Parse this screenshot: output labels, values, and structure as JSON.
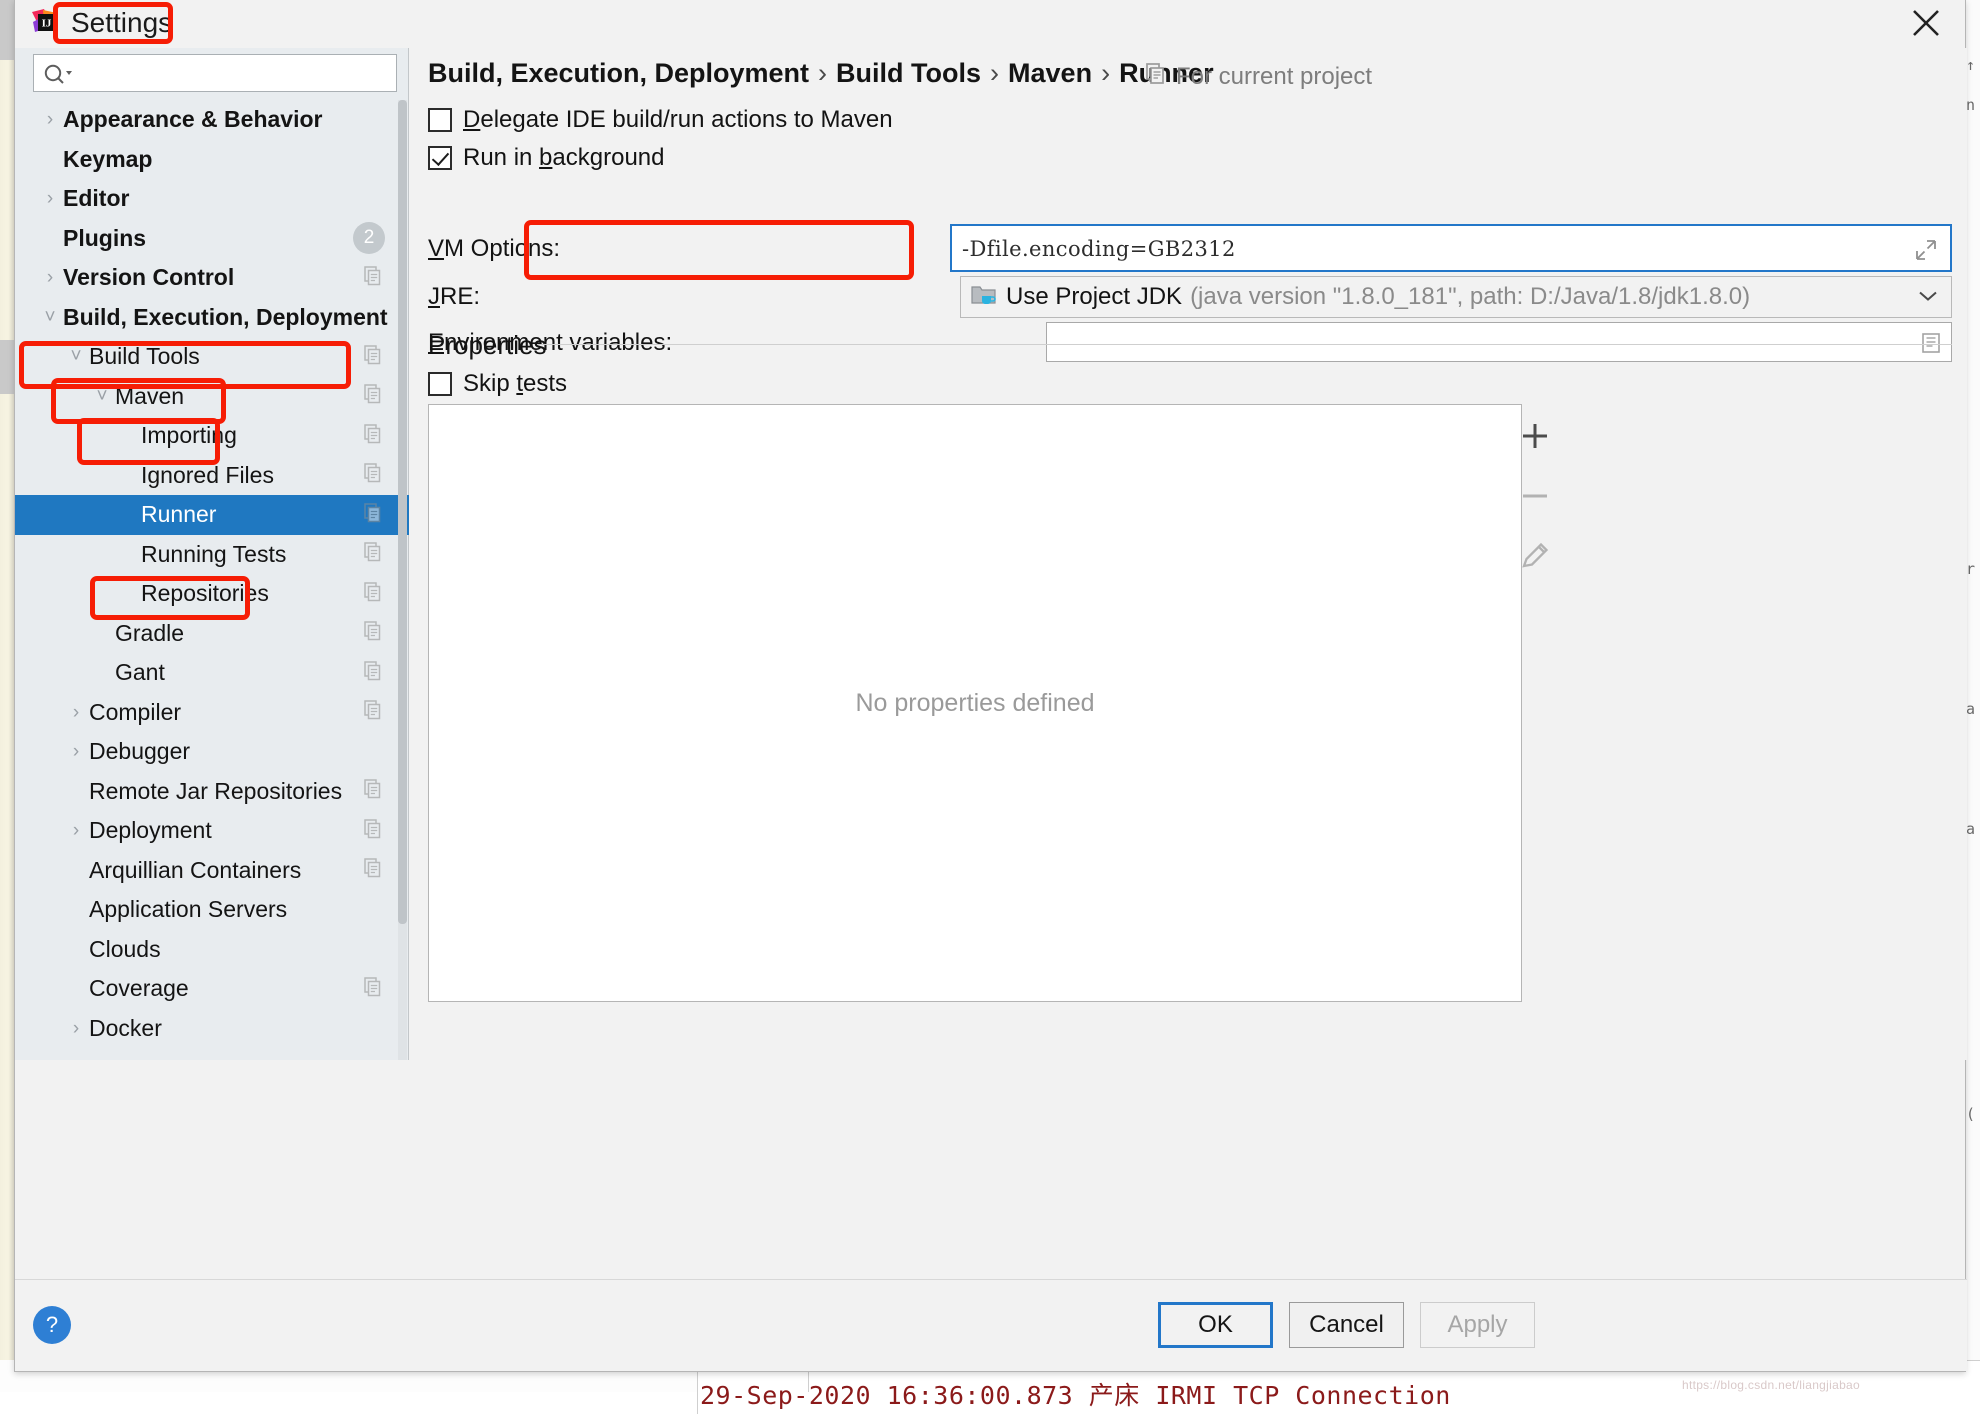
{
  "window": {
    "title": "Settings",
    "app_icon": "intellij-idea-logo",
    "close_icon": "close-icon"
  },
  "search": {
    "value": "",
    "placeholder": "",
    "icon": "search-icon"
  },
  "sidebar": {
    "items": [
      {
        "label": "Appearance & Behavior",
        "arrow": "›",
        "indent": 0,
        "bold": true,
        "copy": false,
        "selected": false
      },
      {
        "label": "Keymap",
        "arrow": "",
        "indent": 0,
        "bold": true,
        "copy": false,
        "selected": false
      },
      {
        "label": "Editor",
        "arrow": "›",
        "indent": 0,
        "bold": true,
        "copy": false,
        "selected": false
      },
      {
        "label": "Plugins",
        "arrow": "",
        "indent": 0,
        "bold": true,
        "copy": false,
        "selected": false,
        "badge": "2"
      },
      {
        "label": "Version Control",
        "arrow": "›",
        "indent": 0,
        "bold": true,
        "copy": true,
        "selected": false
      },
      {
        "label": "Build, Execution, Deployment",
        "arrow": "˅",
        "indent": 0,
        "bold": true,
        "copy": false,
        "selected": false
      },
      {
        "label": "Build Tools",
        "arrow": "˅",
        "indent": 1,
        "bold": false,
        "copy": true,
        "selected": false
      },
      {
        "label": "Maven",
        "arrow": "˅",
        "indent": 2,
        "bold": false,
        "copy": true,
        "selected": false
      },
      {
        "label": "Importing",
        "arrow": "",
        "indent": 3,
        "bold": false,
        "copy": true,
        "selected": false
      },
      {
        "label": "Ignored Files",
        "arrow": "",
        "indent": 3,
        "bold": false,
        "copy": true,
        "selected": false
      },
      {
        "label": "Runner",
        "arrow": "",
        "indent": 3,
        "bold": false,
        "copy": true,
        "selected": true
      },
      {
        "label": "Running Tests",
        "arrow": "",
        "indent": 3,
        "bold": false,
        "copy": true,
        "selected": false
      },
      {
        "label": "Repositories",
        "arrow": "",
        "indent": 3,
        "bold": false,
        "copy": true,
        "selected": false
      },
      {
        "label": "Gradle",
        "arrow": "",
        "indent": 2,
        "bold": false,
        "copy": true,
        "selected": false
      },
      {
        "label": "Gant",
        "arrow": "",
        "indent": 2,
        "bold": false,
        "copy": true,
        "selected": false
      },
      {
        "label": "Compiler",
        "arrow": "›",
        "indent": 1,
        "bold": false,
        "copy": true,
        "selected": false
      },
      {
        "label": "Debugger",
        "arrow": "›",
        "indent": 1,
        "bold": false,
        "copy": false,
        "selected": false
      },
      {
        "label": "Remote Jar Repositories",
        "arrow": "",
        "indent": 1,
        "bold": false,
        "copy": true,
        "selected": false
      },
      {
        "label": "Deployment",
        "arrow": "›",
        "indent": 1,
        "bold": false,
        "copy": true,
        "selected": false
      },
      {
        "label": "Arquillian Containers",
        "arrow": "",
        "indent": 1,
        "bold": false,
        "copy": true,
        "selected": false
      },
      {
        "label": "Application Servers",
        "arrow": "",
        "indent": 1,
        "bold": false,
        "copy": false,
        "selected": false
      },
      {
        "label": "Clouds",
        "arrow": "",
        "indent": 1,
        "bold": false,
        "copy": false,
        "selected": false
      },
      {
        "label": "Coverage",
        "arrow": "",
        "indent": 1,
        "bold": false,
        "copy": true,
        "selected": false
      },
      {
        "label": "Docker",
        "arrow": "›",
        "indent": 1,
        "bold": false,
        "copy": false,
        "selected": false
      }
    ]
  },
  "header": {
    "breadcrumb": [
      "Build, Execution, Deployment",
      "Build Tools",
      "Maven",
      "Runner"
    ],
    "separator": "›",
    "scope_label": "For current project",
    "scope_icon": "copy-document-icon"
  },
  "form": {
    "delegate": {
      "label_pre": "",
      "label_mnemonic": "D",
      "label_post": "elegate IDE build/run actions to Maven",
      "checked": false
    },
    "run_in_background": {
      "label_pre": "Run in ",
      "label_mnemonic": "b",
      "label_post": "ackground",
      "checked": true
    },
    "vm_options": {
      "label_mnemonic": "V",
      "label_post": "M Options:",
      "value": "-Dfile.encoding=GB2312",
      "expand_icon": "expand-diagonal-icon"
    },
    "jre": {
      "label_mnemonic": "J",
      "label_post": "RE:",
      "value_main": "Use Project JDK",
      "value_detail": "(java version \"1.8.0_181\", path: D:/Java/1.8/jdk1.8.0)",
      "icon": "jdk-folder-icon",
      "arrow_icon": "chevron-down-icon"
    },
    "environment_variables": {
      "label_mnemonic": "E",
      "label_post": "nvironment variables:",
      "value": "",
      "browse_icon": "variables-list-icon"
    },
    "properties_section": "Properties",
    "skip_tests": {
      "label_pre": "Skip ",
      "label_mnemonic": "t",
      "label_post": "ests",
      "checked": false
    },
    "properties_empty_text": "No properties defined",
    "properties_toolbar": [
      {
        "icon": "plus-icon",
        "name": "add-property-button",
        "enabled": true,
        "glyph": "+"
      },
      {
        "icon": "minus-icon",
        "name": "remove-property-button",
        "enabled": false,
        "glyph": "−"
      },
      {
        "icon": "pencil-icon",
        "name": "edit-property-button",
        "enabled": false,
        "glyph": "✎"
      }
    ]
  },
  "footer": {
    "help_glyph": "?",
    "ok_label": "OK",
    "cancel_label": "Cancel",
    "apply_label": "Apply"
  },
  "background": {
    "console_line": "29-Sep-2020 16:36:00.873 产床  IRMI TCP Connection",
    "watermark": "https://blog.csdn.net/liangjiabao",
    "right_chars": [
      "↑",
      "n",
      "r",
      "a",
      "a",
      "("
    ]
  },
  "colors": {
    "selection_blue": "#1f78c1",
    "focus_blue": "#2377c9",
    "annotation_red": "#f61d05",
    "sidebar_bg": "#e8ecef",
    "panel_bg": "#f2f2f2",
    "muted_text": "#8a8a8a"
  }
}
